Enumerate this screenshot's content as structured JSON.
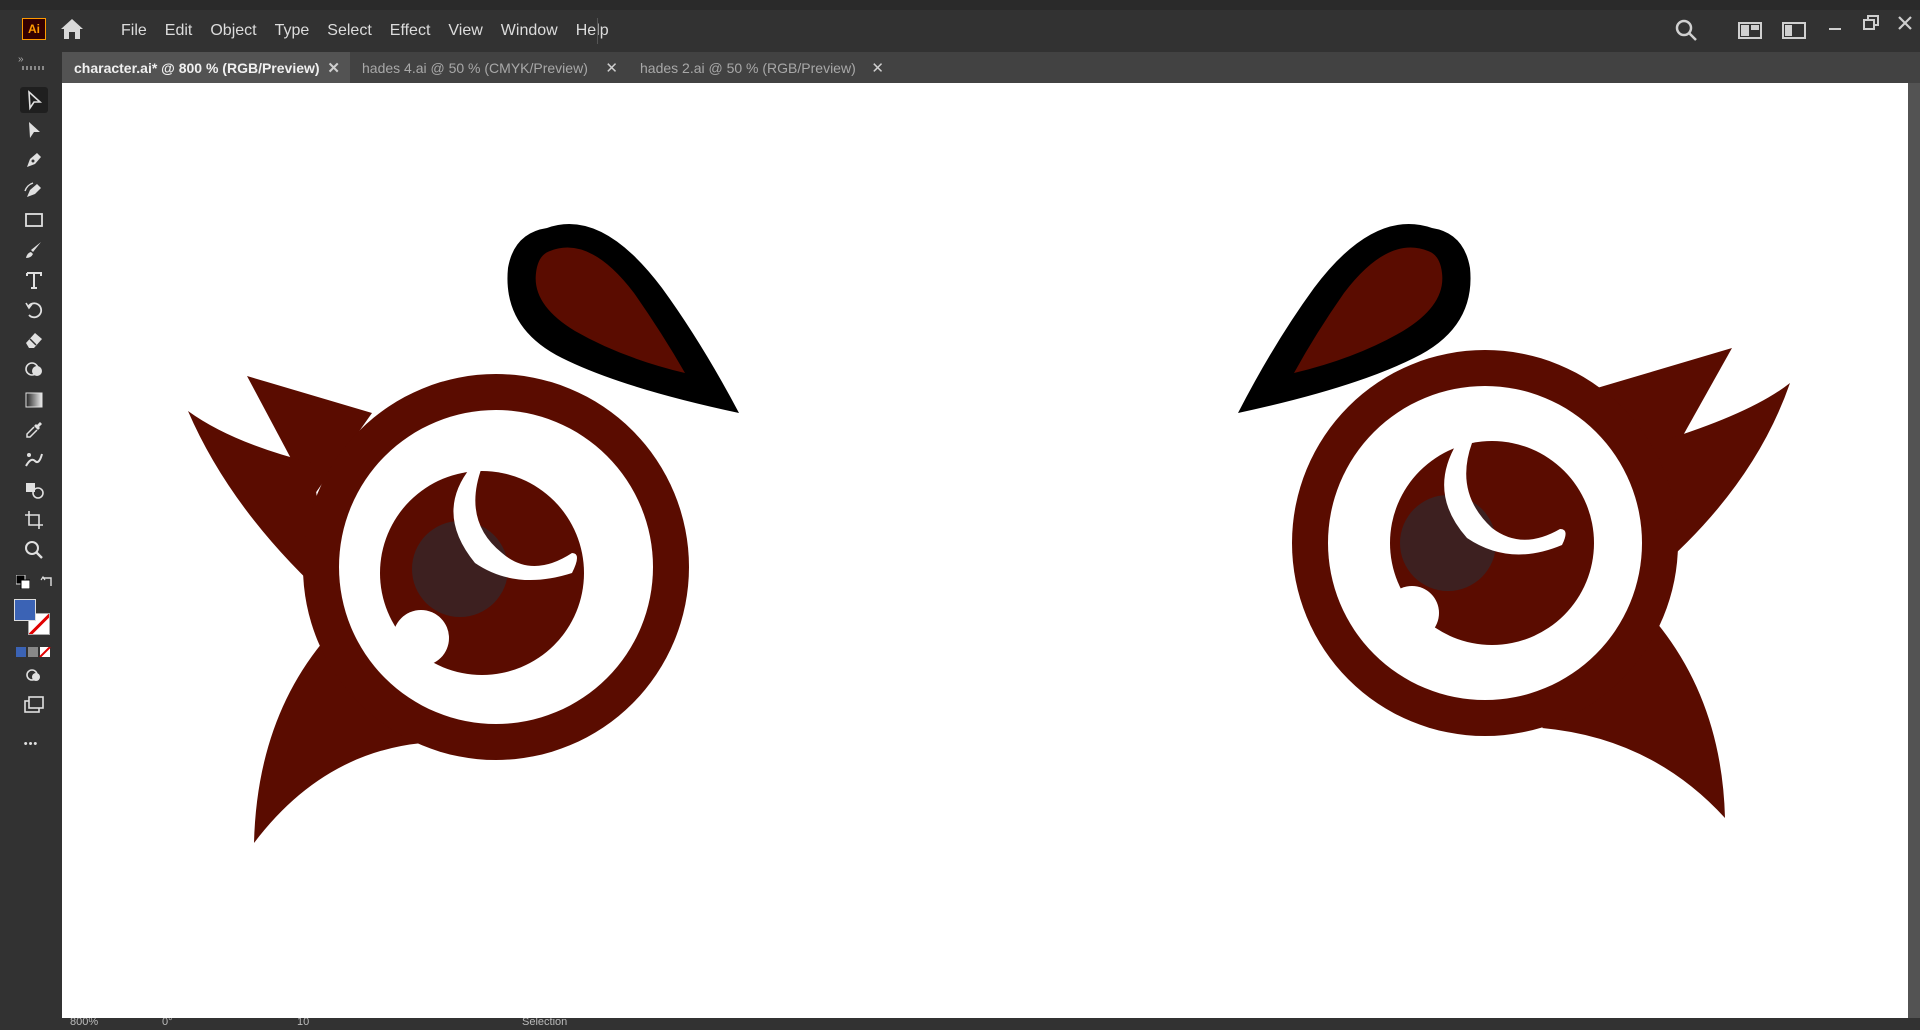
{
  "app": {
    "logo_text": "Ai"
  },
  "menu": [
    "File",
    "Edit",
    "Object",
    "Type",
    "Select",
    "Effect",
    "View",
    "Window",
    "Help"
  ],
  "tabs": [
    {
      "label": "character.ai* @ 800 % (RGB/Preview)",
      "active": true
    },
    {
      "label": "hades 4.ai @ 50 % (CMYK/Preview)",
      "active": false
    },
    {
      "label": "hades 2.ai @ 50 % (RGB/Preview)",
      "active": false
    }
  ],
  "tab_close_glyph": "✕",
  "toolbar": {
    "collapse_glyph": "»",
    "more_glyph": "•••",
    "tools": [
      "selection-tool-icon",
      "direct-selection-tool-icon",
      "pen-tool-icon",
      "curvature-tool-icon",
      "rectangle-tool-icon",
      "paintbrush-tool-icon",
      "type-tool-icon",
      "rotate-tool-icon",
      "eraser-tool-icon",
      "shape-builder-tool-icon",
      "gradient-tool-icon",
      "eyedropper-tool-icon",
      "puppet-warp-tool-icon",
      "blend-tool-icon",
      "artboard-tool-icon",
      "zoom-tool-icon"
    ]
  },
  "colors": {
    "fill": "#3b63b5",
    "eye_dark": "#5a0c00",
    "iris_shade": "#3d2020",
    "brow_outline": "#000000",
    "canvas": "#ffffff"
  },
  "status": {
    "zoom": "800%",
    "rotate": "0°",
    "artboard": "10",
    "tool": "Selection"
  }
}
